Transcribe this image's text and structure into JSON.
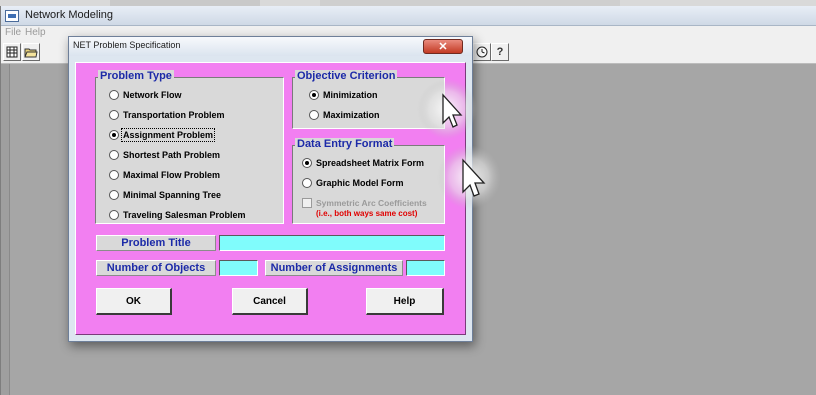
{
  "app": {
    "title": "Network Modeling",
    "menu": [
      "File",
      "Help"
    ]
  },
  "toolbar": {
    "icons": [
      "new-document-icon",
      "open-folder-icon",
      "clock-icon",
      "help-question-icon"
    ]
  },
  "dialog": {
    "title": "NET Problem Specification",
    "close_glyph": "✕",
    "problem_type": {
      "title": "Problem Type",
      "options": [
        "Network Flow",
        "Transportation Problem",
        "Assignment Problem",
        "Shortest Path Problem",
        "Maximal Flow Problem",
        "Minimal Spanning Tree",
        "Traveling Salesman Problem"
      ],
      "selected": "Assignment Problem"
    },
    "objective": {
      "title": "Objective Criterion",
      "options": [
        "Minimization",
        "Maximization"
      ],
      "selected": "Minimization"
    },
    "data_entry": {
      "title": "Data Entry Format",
      "options": [
        "Spreadsheet Matrix Form",
        "Graphic Model Form"
      ],
      "selected": "Spreadsheet Matrix Form",
      "symmetric_label": "Symmetric Arc Coefficients",
      "symmetric_note": "(i.e., both ways same cost)",
      "symmetric_checked": false
    },
    "fields": {
      "problem_title_label": "Problem Title",
      "problem_title_value": "",
      "num_objects_label": "Number of Objects",
      "num_objects_value": "",
      "num_assignments_label": "Number of Assignments",
      "num_assignments_value": ""
    },
    "buttons": {
      "ok": "OK",
      "cancel": "Cancel",
      "help": "Help"
    }
  },
  "colors": {
    "dialog_body": "#f27ff1",
    "group_title": "#1c2aa8",
    "input_fill": "#80fcfc",
    "note_red": "#e00000"
  }
}
